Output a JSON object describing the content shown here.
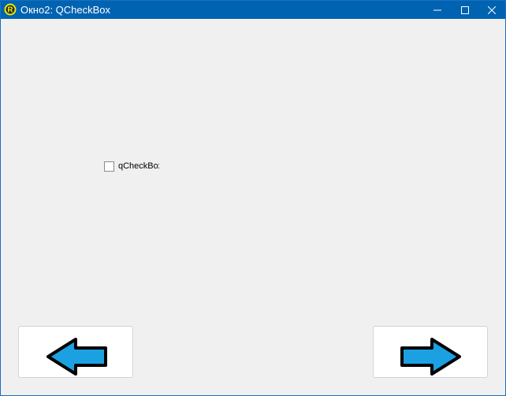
{
  "window": {
    "title": "Окно2: QCheckBox",
    "icon": "r-logo-icon",
    "controls": [
      "minimize-icon",
      "maximize-icon",
      "close-icon"
    ]
  },
  "content": {
    "checkbox": {
      "label": "qCheckBox",
      "checked": false
    },
    "back_button": {
      "icon": "arrow-left-icon"
    },
    "forward_button": {
      "icon": "arrow-right-icon"
    }
  },
  "colors": {
    "titlebar": "#0063b1",
    "background": "#f0f0f0",
    "arrow_fill": "#1ba1e2",
    "arrow_stroke": "#000000",
    "icon_yellow": "#e8e800"
  }
}
